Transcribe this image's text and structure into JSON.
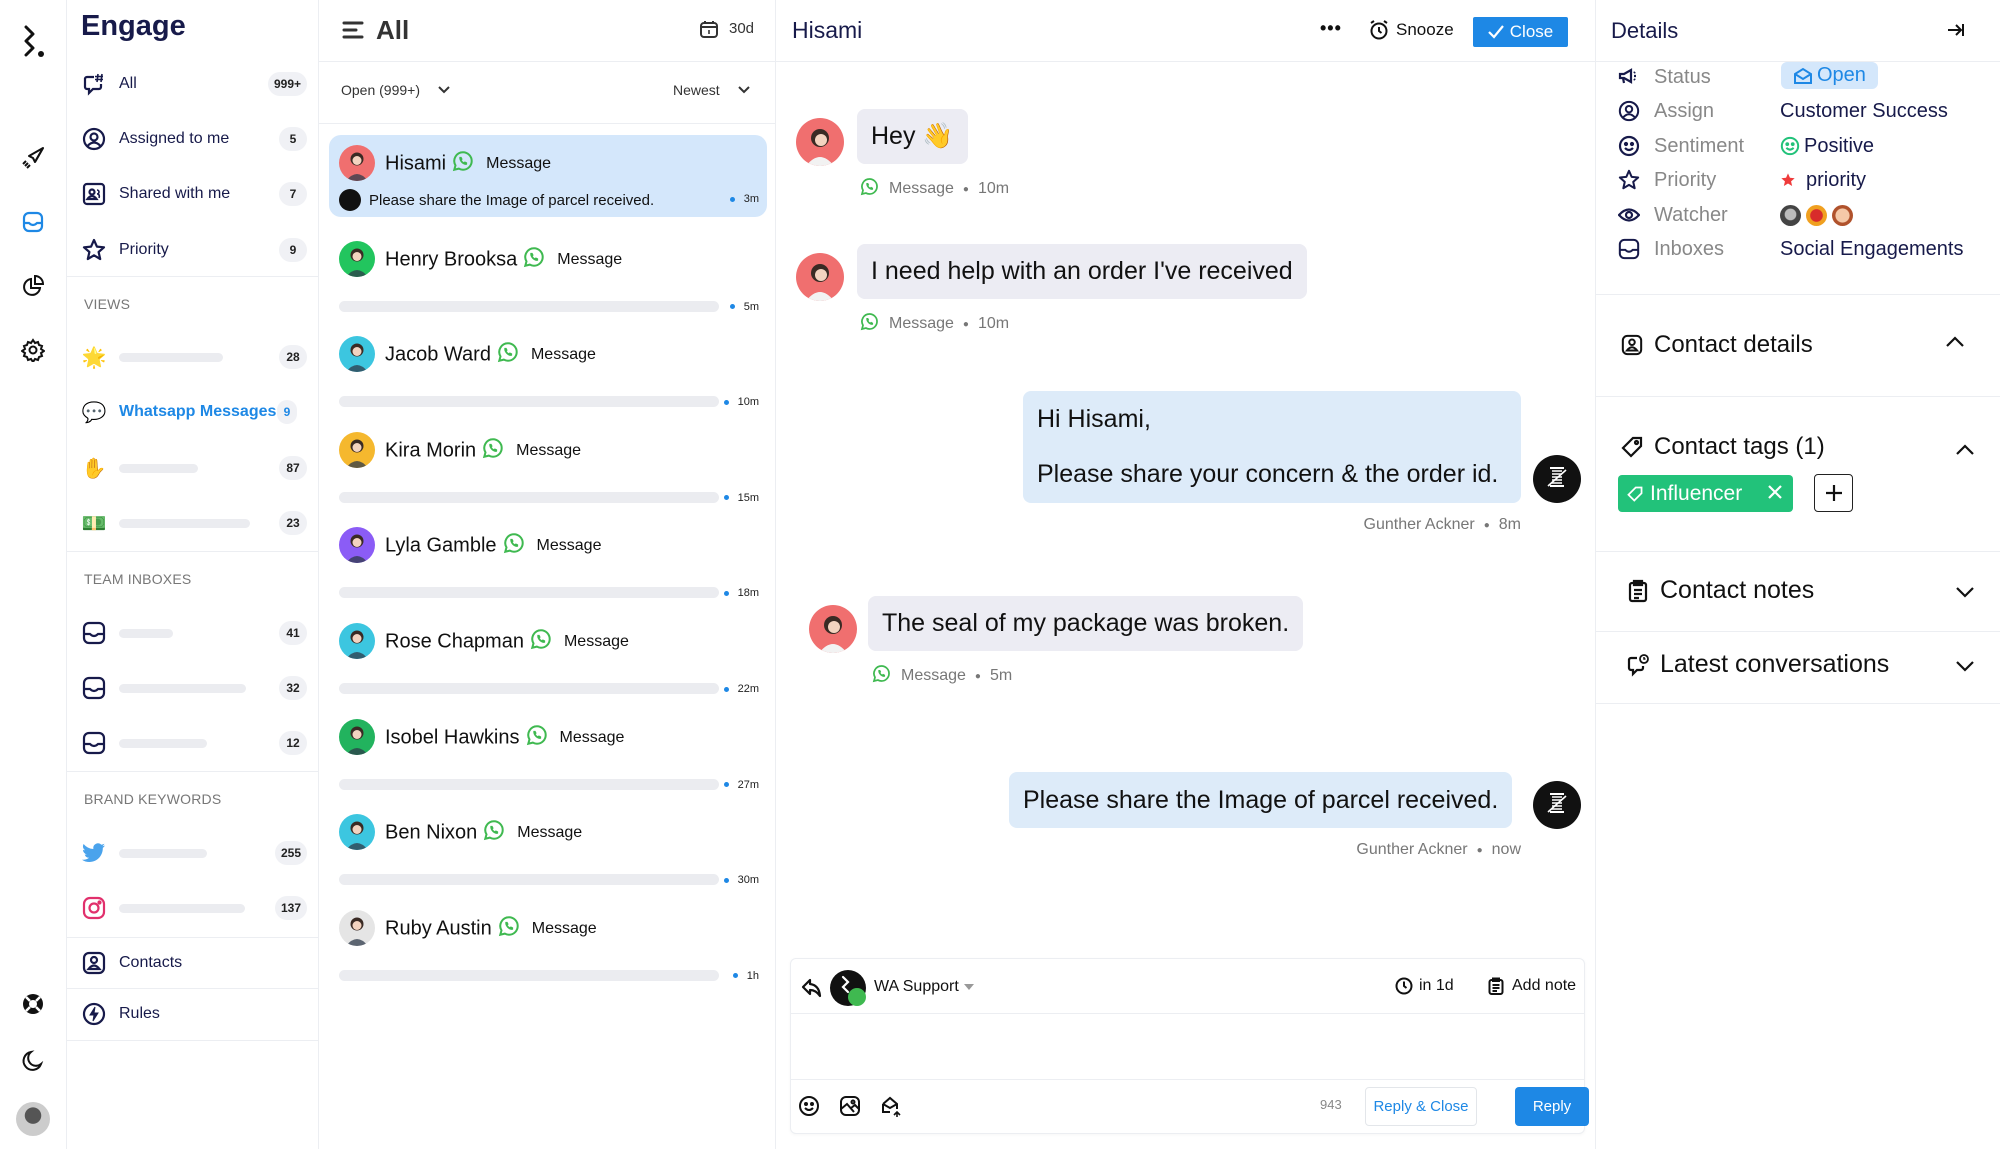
{
  "app": {
    "title": "Engage"
  },
  "rail": {
    "icons": [
      "logo-icon",
      "campaign-icon",
      "inbox-icon",
      "reports-icon",
      "settings-icon",
      "help-icon",
      "dark-mode-icon",
      "user-avatar"
    ],
    "active": "inbox-icon",
    "active_color": "#1e88e5"
  },
  "nav": {
    "title": "Engage",
    "items": [
      {
        "label": "All",
        "count": "999+",
        "icon": "all-conversations-icon"
      },
      {
        "label": "Assigned to me",
        "count": "5",
        "icon": "user-circle-icon"
      },
      {
        "label": "Shared with me",
        "count": "7",
        "icon": "shared-users-icon"
      },
      {
        "label": "Priority",
        "count": "9",
        "icon": "star-icon"
      }
    ],
    "views_heading": "VIEWS",
    "views": [
      {
        "emoji": "🌟",
        "label": "",
        "count": "28"
      },
      {
        "emoji": "💬",
        "label": "Whatsapp Messages",
        "count": "9",
        "active": true
      },
      {
        "emoji": "✋",
        "label": "",
        "count": "87"
      },
      {
        "emoji": "💵",
        "label": "",
        "count": "23"
      }
    ],
    "team_heading": "TEAM INBOXES",
    "team": [
      {
        "label": "",
        "count": "41"
      },
      {
        "label": "",
        "count": "32"
      },
      {
        "label": "",
        "count": "12"
      }
    ],
    "brand_heading": "BRAND KEYWORDS",
    "brand": [
      {
        "network": "twitter",
        "label": "",
        "count": "255"
      },
      {
        "network": "instagram",
        "label": "",
        "count": "137"
      }
    ],
    "contacts_label": "Contacts",
    "rules_label": "Rules"
  },
  "list": {
    "title": "All",
    "date_range": "30d",
    "status_filter": "Open (999+)",
    "sort": "Newest",
    "conversations": [
      {
        "name": "Hisami",
        "channel": "Message",
        "preview": "Please share the Image of parcel received.",
        "time": "3m",
        "selected": true,
        "avatar_bg": "#f06f6f"
      },
      {
        "name": "Henry Brooksa",
        "channel": "Message",
        "preview": "",
        "time": "5m",
        "avatar_bg": "#22c55e"
      },
      {
        "name": "Jacob Ward",
        "channel": "Message",
        "preview": "",
        "time": "10m",
        "avatar_bg": "#3cc6e0"
      },
      {
        "name": "Kira Morin",
        "channel": "Message",
        "preview": "",
        "time": "15m",
        "avatar_bg": "#f5b82e"
      },
      {
        "name": "Lyla Gamble",
        "channel": "Message",
        "preview": "",
        "time": "18m",
        "avatar_bg": "#8b5cf6"
      },
      {
        "name": "Rose Chapman",
        "channel": "Message",
        "preview": "",
        "time": "22m",
        "avatar_bg": "#3cc6e0"
      },
      {
        "name": "Isobel Hawkins",
        "channel": "Message",
        "preview": "",
        "time": "27m",
        "avatar_bg": "#22b35e"
      },
      {
        "name": "Ben Nixon",
        "channel": "Message",
        "preview": "",
        "time": "30m",
        "avatar_bg": "#3cc6e0"
      },
      {
        "name": "Ruby Austin",
        "channel": "Message",
        "preview": "",
        "time": "1h",
        "avatar_bg": "#e5e5e5"
      }
    ]
  },
  "chat": {
    "contact_name": "Hisami",
    "more_label": "•••",
    "snooze_label": "Snooze",
    "close_label": "Close",
    "messages": [
      {
        "direction": "in",
        "text": "Hey 👋",
        "channel": "Message",
        "time": "10m"
      },
      {
        "direction": "in",
        "text": "I need help with an order I've received",
        "channel": "Message",
        "time": "10m"
      },
      {
        "direction": "out",
        "lines": [
          "Hi Hisami,",
          "Please share your concern & the order id."
        ],
        "author": "Gunther Ackner",
        "time": "8m"
      },
      {
        "direction": "in",
        "text": "The seal of my package was broken.",
        "channel": "Message",
        "time": "5m"
      },
      {
        "direction": "out",
        "text": "Please share the Image of parcel received.",
        "author": "Gunther Ackner",
        "time": "now"
      }
    ],
    "reply": {
      "account": "WA Support",
      "schedule": "in 1d",
      "add_note": "Add note",
      "char_count": "943",
      "reply_close_label": "Reply & Close",
      "reply_label": "Reply",
      "value": ""
    }
  },
  "details": {
    "title": "Details",
    "fields": [
      {
        "key": "Status",
        "value": "Open",
        "icon": "megaphone-icon"
      },
      {
        "key": "Assign",
        "value": "Customer Success",
        "icon": "user-circle-icon"
      },
      {
        "key": "Sentiment",
        "value": "Positive",
        "icon": "smiley-icon"
      },
      {
        "key": "Priority",
        "value": "priority",
        "icon": "star-icon"
      },
      {
        "key": "Watcher",
        "value": "",
        "icon": "eye-icon"
      },
      {
        "key": "Inboxes",
        "value": "Social Engagements",
        "icon": "inbox-icon"
      }
    ],
    "sections": {
      "contact_details": "Contact details",
      "contact_tags": "Contact tags (1)",
      "contact_notes": "Contact notes",
      "latest_conversations": "Latest conversations"
    },
    "tags": [
      {
        "label": "Influencer",
        "color": "#22c27a"
      }
    ]
  },
  "colors": {
    "accent": "#1e88e5",
    "selected_bg": "#d4e7fb",
    "whatsapp": "#3fb950",
    "navy": "#171a4a",
    "tag_green": "#22c27a",
    "status_bg": "#d4e7fb"
  }
}
